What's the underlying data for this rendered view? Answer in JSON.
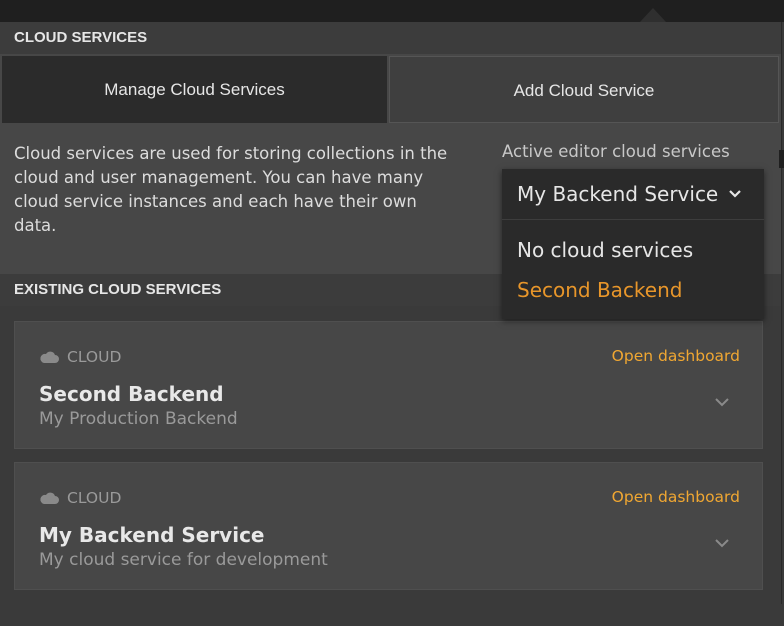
{
  "header": {
    "title": "CLOUD SERVICES"
  },
  "tabs": [
    {
      "label": "Manage Cloud Services",
      "active": true
    },
    {
      "label": "Add Cloud Service",
      "active": false
    }
  ],
  "description": "Cloud services are used for storing collections in the cloud and user management. You can have many cloud service instances and each have their own data.",
  "active_editor": {
    "label": "Active editor cloud services",
    "selected": "My Backend Service",
    "options": [
      "No cloud services",
      "Second Backend"
    ]
  },
  "existing": {
    "title": "EXISTING CLOUD SERVICES",
    "services": [
      {
        "kind": "CLOUD",
        "name": "Second Backend",
        "description": "My Production Backend",
        "action": "Open dashboard"
      },
      {
        "kind": "CLOUD",
        "name": "My Backend Service",
        "description": "My cloud service for development",
        "action": "Open dashboard"
      }
    ]
  },
  "colors": {
    "accent": "#f0a732",
    "option_highlight": "#e8962a",
    "panel": "#474747",
    "dark": "#2b2b2b"
  }
}
